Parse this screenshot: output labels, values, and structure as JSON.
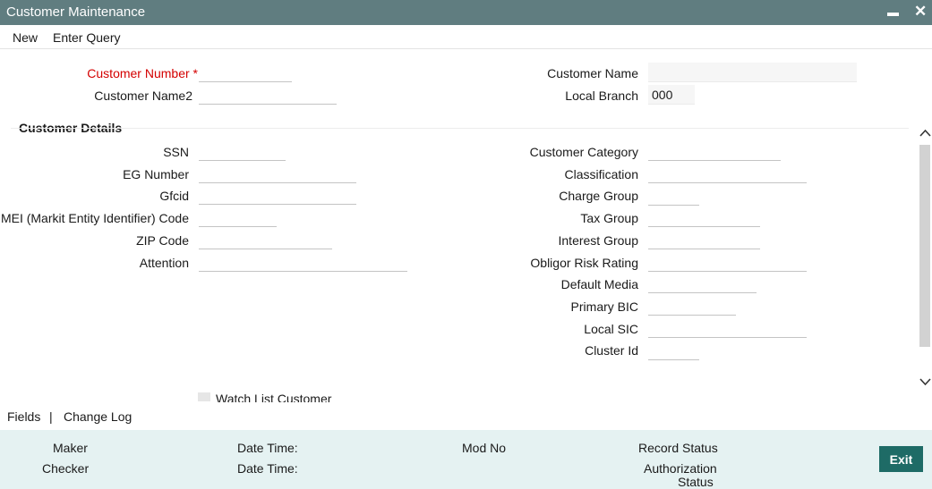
{
  "window": {
    "title": "Customer Maintenance",
    "minimize_glyph": "▬",
    "close_glyph": "✕"
  },
  "menu": {
    "items": [
      "New",
      "Enter Query"
    ]
  },
  "header": {
    "customer_number_label": "Customer Number",
    "required_mark": "*",
    "customer_number_value": "",
    "customer_name2_label": "Customer Name2",
    "customer_name2_value": "",
    "customer_name_label": "Customer Name",
    "customer_name_value": "",
    "local_branch_label": "Local Branch",
    "local_branch_value": "000"
  },
  "customer_details": {
    "title": "Customer Details",
    "left_fields": [
      {
        "label": "SSN",
        "value": ""
      },
      {
        "label": "EG Number",
        "value": ""
      },
      {
        "label": "Gfcid",
        "value": ""
      },
      {
        "label": "MEI (Markit Entity Identifier) Code",
        "value": ""
      },
      {
        "label": "ZIP Code",
        "value": ""
      },
      {
        "label": "Attention",
        "value": ""
      }
    ],
    "right_fields": [
      {
        "label": "Customer Category",
        "value": ""
      },
      {
        "label": "Classification",
        "value": ""
      },
      {
        "label": "Charge Group",
        "value": ""
      },
      {
        "label": "Tax Group",
        "value": ""
      },
      {
        "label": "Interest Group",
        "value": ""
      },
      {
        "label": "Obligor Risk Rating",
        "value": ""
      },
      {
        "label": "Default Media",
        "value": ""
      },
      {
        "label": "Primary BIC",
        "value": ""
      },
      {
        "label": "Local SIC",
        "value": ""
      },
      {
        "label": "Cluster Id",
        "value": ""
      }
    ],
    "watch_list_label": "Watch List Customer",
    "watch_list_checked": false
  },
  "scrollbar": {
    "up_icon": "chevron-up-icon",
    "down_icon": "chevron-down-icon"
  },
  "bottom_tabs": {
    "fields": "Fields",
    "separator": "|",
    "change_log": "Change Log"
  },
  "footer": {
    "maker": "Maker",
    "checker": "Checker",
    "date_time_1": "Date Time:",
    "date_time_2": "Date Time:",
    "mod_no": "Mod No",
    "record_status": "Record Status",
    "authorization_status_line1": "Authorization",
    "authorization_status_line2": "Status",
    "exit_label": "Exit"
  },
  "colors": {
    "titlebar": "#607d80",
    "required": "#d40000",
    "footer_bg": "#e5f2f2",
    "exit_button": "#1e6b66"
  }
}
